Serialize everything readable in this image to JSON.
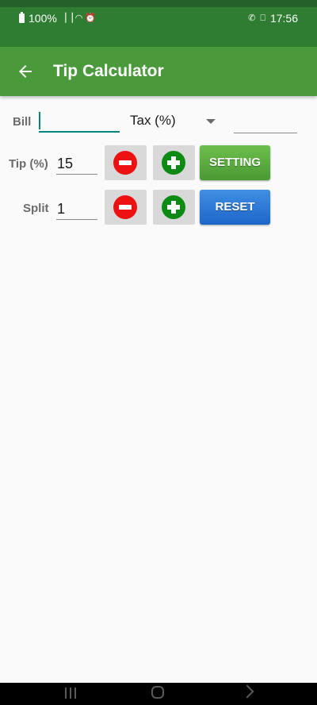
{
  "status_bar": {
    "battery": "100%",
    "time": "17:56",
    "icons": [
      "battery-icon",
      "signal-icon",
      "wifi-icon",
      "alarm-icon",
      "whatsapp-icon",
      "laptop-icon"
    ]
  },
  "app_bar": {
    "title": "Tip Calculator",
    "back_icon": "back-arrow-icon"
  },
  "form": {
    "bill": {
      "label": "Bill",
      "value": ""
    },
    "tax": {
      "select_label": "Tax (%)",
      "value": ""
    },
    "tip": {
      "label": "Tip (%)",
      "value": "15"
    },
    "split": {
      "label": "Split",
      "value": "1"
    },
    "setting_label": "SETTING",
    "reset_label": "RESET"
  },
  "colors": {
    "status_bar": "#2e7d32",
    "app_bar": "#4a9a3c",
    "accent_teal": "#00897b",
    "minus_red": "#ee1111",
    "plus_green": "#0d8a12",
    "setting_green": "#5aa83f",
    "reset_blue": "#2a7ad6"
  }
}
